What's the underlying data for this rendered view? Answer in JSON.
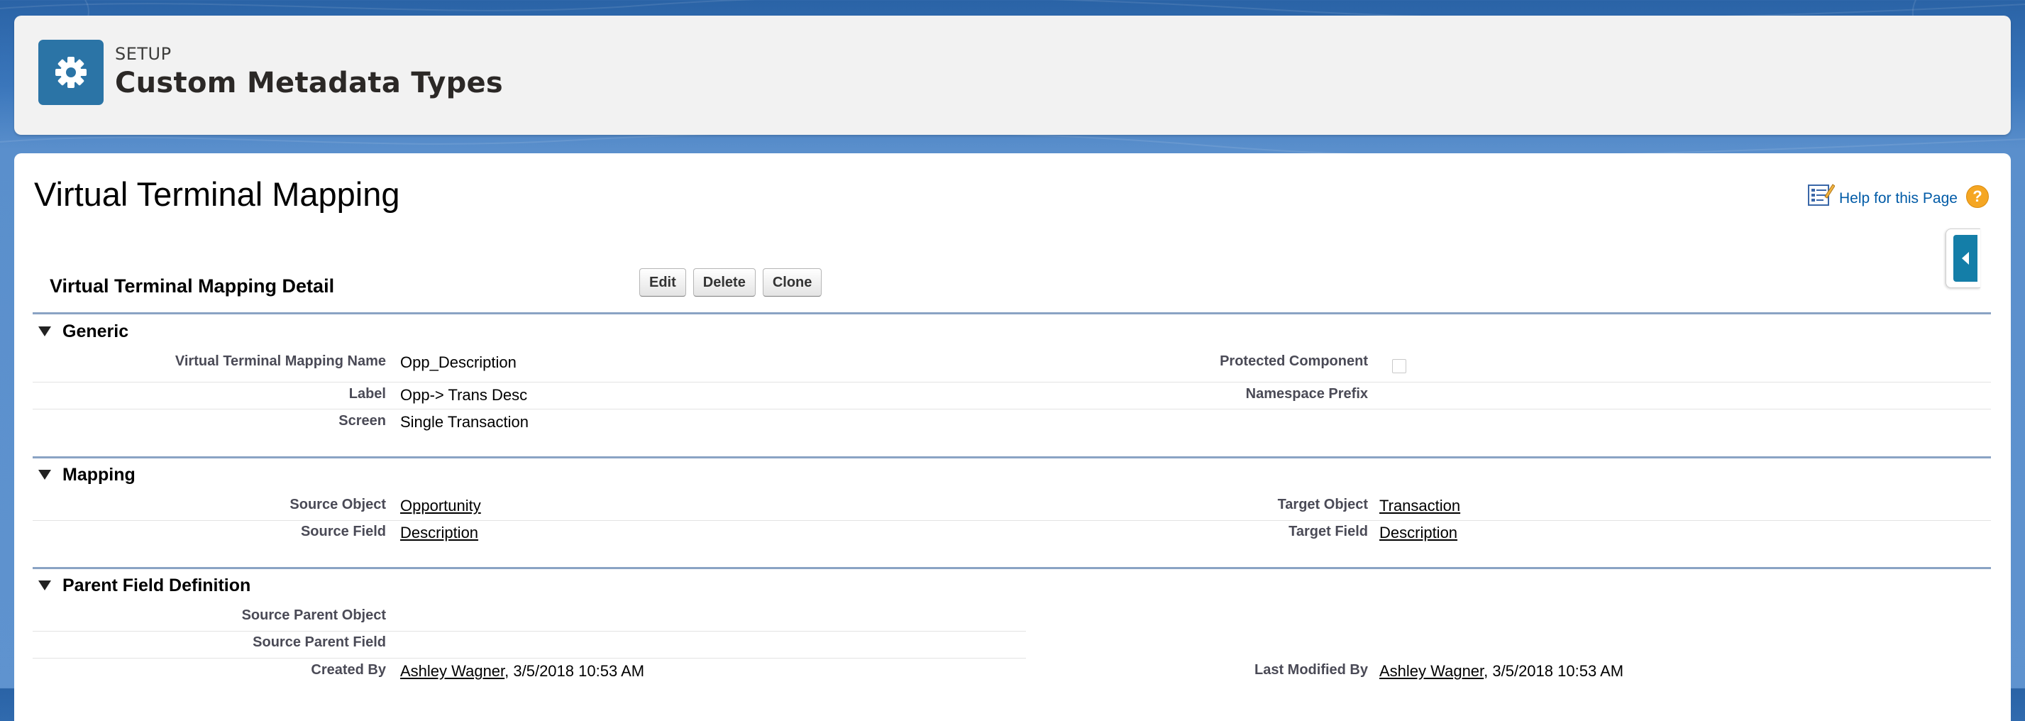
{
  "header": {
    "eyebrow": "SETUP",
    "title": "Custom Metadata Types",
    "icon": "gear-icon"
  },
  "page": {
    "title": "Virtual Terminal Mapping",
    "help_text": "Help for this Page",
    "help_icons": [
      "help-doc-icon",
      "question-icon"
    ]
  },
  "detail": {
    "title": "Virtual Terminal Mapping Detail",
    "buttons": {
      "edit": "Edit",
      "delete": "Delete",
      "clone": "Clone"
    }
  },
  "sections": {
    "generic": {
      "title": "Generic",
      "vtm_name_label": "Virtual Terminal Mapping Name",
      "vtm_name_value": "Opp_Description",
      "label_label": "Label",
      "label_value": "Opp-> Trans Desc",
      "screen_label": "Screen",
      "screen_value": "Single Transaction",
      "protected_label": "Protected Component",
      "protected_checked": false,
      "namespace_label": "Namespace Prefix",
      "namespace_value": ""
    },
    "mapping": {
      "title": "Mapping",
      "source_object_label": "Source Object",
      "source_object_value": "Opportunity",
      "source_field_label": "Source Field",
      "source_field_value": "Description",
      "target_object_label": "Target Object",
      "target_object_value": "Transaction",
      "target_field_label": "Target Field",
      "target_field_value": "Description"
    },
    "parent": {
      "title": "Parent Field Definition",
      "source_parent_object_label": "Source Parent Object",
      "source_parent_object_value": "",
      "source_parent_field_label": "Source Parent Field",
      "source_parent_field_value": "",
      "created_by_label": "Created By",
      "created_by_user": "Ashley Wagner",
      "created_by_date": ", 3/5/2018 10:53 AM",
      "modified_by_label": "Last Modified By",
      "modified_by_user": "Ashley Wagner",
      "modified_by_date": ", 3/5/2018 10:53 AM"
    }
  },
  "colors": {
    "background_blue": "#2a63a6",
    "icon_blue": "#2b74a6",
    "link_blue": "#015ba7",
    "section_rule": "#8aa3c4",
    "help_orange": "#f5a623"
  }
}
